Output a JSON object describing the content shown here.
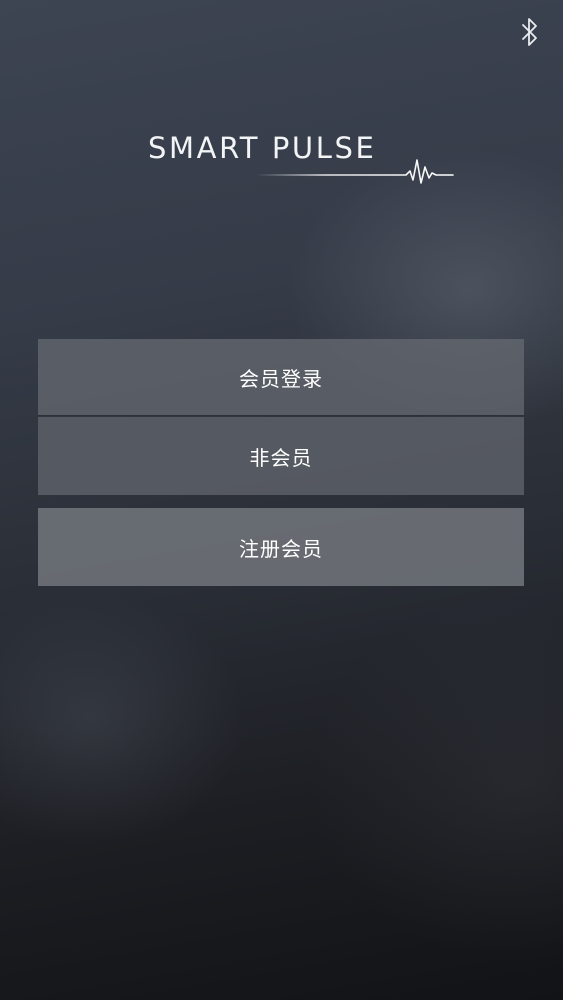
{
  "app": {
    "logo_text": "SMART PULSE"
  },
  "menu": {
    "member_login_label": "会员登录",
    "guest_label": "非会员",
    "register_label": "注册会员"
  },
  "icons": {
    "top_right": "bluetooth-icon",
    "logo_decoration": "heartbeat-pulse-icon"
  },
  "colors": {
    "background_top": "#3d4452",
    "background_bottom": "#121316",
    "button_fill": "#64686f",
    "register_fill": "#70747a",
    "text": "#ffffff"
  }
}
